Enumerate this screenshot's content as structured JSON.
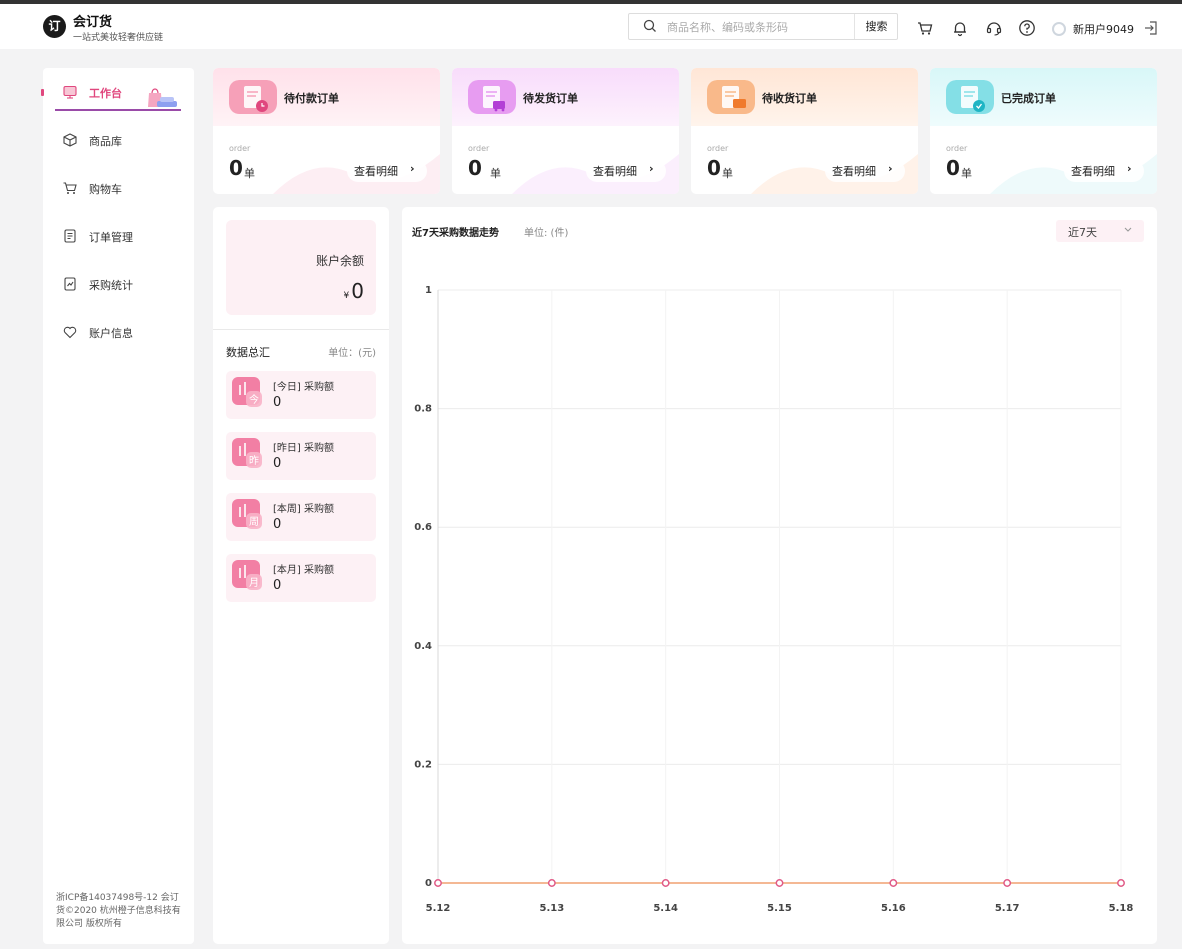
{
  "header": {
    "logo_mark": "订",
    "brand_name": "会订货",
    "brand_tagline": "一站式美妆轻奢供应链",
    "search_placeholder": "商品名称、编码或条形码",
    "search_button": "搜索",
    "username": "新用户9049",
    "icons": [
      "cart-icon",
      "bell-icon",
      "headset-icon",
      "help-icon",
      "avatar",
      "logout-icon"
    ]
  },
  "sidebar": {
    "items": [
      {
        "label": "工作台",
        "icon": "monitor-icon",
        "active": true
      },
      {
        "label": "商品库",
        "icon": "cube-icon",
        "active": false
      },
      {
        "label": "购物车",
        "icon": "cart-icon",
        "active": false
      },
      {
        "label": "订单管理",
        "icon": "order-list-icon",
        "active": false
      },
      {
        "label": "采购统计",
        "icon": "stats-icon",
        "active": false
      },
      {
        "label": "账户信息",
        "icon": "heart-icon",
        "active": false
      }
    ],
    "footer": "浙ICP备14037498号-12 会订货©2020 杭州橙子信息科技有限公司 版权所有"
  },
  "order_cards": [
    {
      "title": "待付款订单",
      "order_label": "order",
      "count": "0",
      "unit": "单",
      "link": "查看明细",
      "accent": "#ef5f8c",
      "grad_from": "#ffe1ea",
      "grad_to": "#fff3f6"
    },
    {
      "title": "待发货订单",
      "order_label": "order",
      "count": "0",
      "unit": "单",
      "link": "查看明细",
      "accent": "#c75ee8",
      "grad_from": "#f8dcfb",
      "grad_to": "#fdf2fd"
    },
    {
      "title": "待收货订单",
      "order_label": "order",
      "count": "0",
      "unit": "单",
      "link": "查看明细",
      "accent": "#f59450",
      "grad_from": "#ffe6d6",
      "grad_to": "#fff4ec"
    },
    {
      "title": "已完成订单",
      "order_label": "order",
      "count": "0",
      "unit": "单",
      "link": "查看明细",
      "accent": "#35c4d1",
      "grad_from": "#d8f7f8",
      "grad_to": "#effcfd"
    }
  ],
  "account": {
    "balance_label": "账户余额",
    "currency": "¥",
    "balance": "0"
  },
  "summary": {
    "title": "数据总汇",
    "unit": "单位：(元)",
    "items": [
      {
        "label": "[今日] 采购额",
        "badge": "今",
        "value": "0"
      },
      {
        "label": "[昨日] 采购额",
        "badge": "昨",
        "value": "0"
      },
      {
        "label": "[本周] 采购额",
        "badge": "周",
        "value": "0"
      },
      {
        "label": "[本月] 采购额",
        "badge": "月",
        "value": "0"
      }
    ]
  },
  "chart_panel": {
    "title": "近7天采购数据走势",
    "unit": "单位: (件)",
    "range": "近7天"
  },
  "chart_data": {
    "type": "line",
    "title": "近7天采购数据走势",
    "x": [
      "5.12",
      "5.13",
      "5.14",
      "5.15",
      "5.16",
      "5.17",
      "5.18"
    ],
    "series": [
      {
        "values": [
          0,
          0,
          0,
          0,
          0,
          0,
          0
        ],
        "color": "#e05a86"
      }
    ],
    "yticks": [
      "0",
      "0.2",
      "0.4",
      "0.6",
      "0.8",
      "1"
    ],
    "ylim": [
      0,
      1
    ],
    "grid": true,
    "legend": "none"
  }
}
